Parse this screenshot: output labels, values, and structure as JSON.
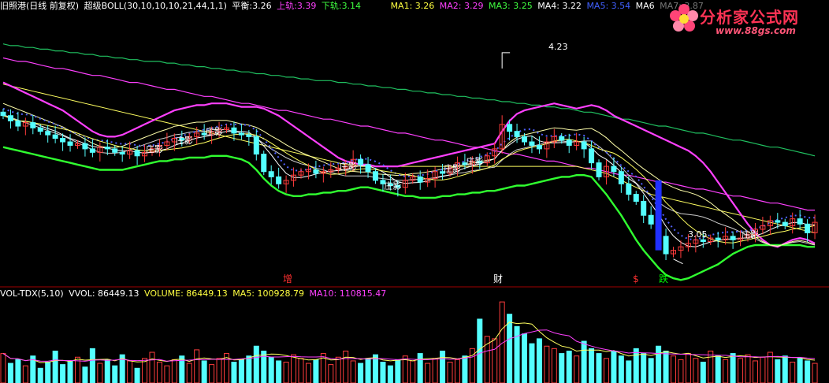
{
  "header": {
    "stock": "旧照港(日线 前复权)",
    "indicator": "超级BOLL(30,10,10,10,21,44,1,1)",
    "balance_label": "平衡:",
    "balance_value": "3.26",
    "upper_label": "上轨:",
    "upper_value": "3.39",
    "lower_label": "下轨:",
    "lower_value": "3.14",
    "ma1": "MA1: 3.26",
    "ma2": "MA2: 3.29",
    "ma3": "MA3: 3.25",
    "ma4": "MA4: 3.22",
    "ma5": "MA5: 3.54",
    "ma6": "MA6",
    "ma7": "MA7: 3.87"
  },
  "vol_header": {
    "name": "VOL-TDX(5,10)",
    "vvol": "VVOL: 86449.13",
    "volume": "VOLUME: 86449.13",
    "ma5": "MA5: 100928.79",
    "ma10": "MA10: 110815.47"
  },
  "logo": {
    "title": "分析家公式网",
    "url": "www.88gs.com"
  },
  "events": [
    {
      "text": "增",
      "color": "#ff3030"
    },
    {
      "text": "财",
      "color": "#ffffff"
    },
    {
      "text": "$",
      "color": "#ff3030"
    },
    {
      "text": "跌",
      "color": "#00ff00"
    }
  ],
  "labels": {
    "high": "4.23",
    "low": "3.05",
    "zhuang": "庄影"
  },
  "colors": {
    "up": "#ff3c3c",
    "down": "#54ffff",
    "upper_band": "#ff40ff",
    "lower_band": "#30ff30",
    "mid_band": "#ffffff",
    "ma_long1": "#ff40ff",
    "ma_long2": "#ffff60",
    "ma_long3": "#20c060",
    "dots": "#5060ff",
    "axis": "#a00000"
  },
  "chart_data": {
    "type": "candlestick",
    "ylim": [
      2.9,
      4.45
    ],
    "grid": false,
    "n_bars": 110,
    "band_upper": [
      4.06,
      4.04,
      4.02,
      4.0,
      3.98,
      3.96,
      3.94,
      3.92,
      3.9,
      3.87,
      3.84,
      3.81,
      3.78,
      3.76,
      3.75,
      3.75,
      3.76,
      3.78,
      3.8,
      3.82,
      3.84,
      3.86,
      3.88,
      3.9,
      3.91,
      3.92,
      3.93,
      3.93,
      3.94,
      3.94,
      3.94,
      3.93,
      3.92,
      3.92,
      3.92,
      3.91,
      3.89,
      3.87,
      3.84,
      3.81,
      3.78,
      3.75,
      3.72,
      3.69,
      3.66,
      3.63,
      3.61,
      3.6,
      3.59,
      3.59,
      3.58,
      3.58,
      3.58,
      3.58,
      3.59,
      3.6,
      3.61,
      3.62,
      3.63,
      3.64,
      3.65,
      3.66,
      3.67,
      3.68,
      3.69,
      3.7,
      3.71,
      3.78,
      3.84,
      3.88,
      3.9,
      3.91,
      3.92,
      3.93,
      3.94,
      3.93,
      3.92,
      3.91,
      3.92,
      3.93,
      3.92,
      3.9,
      3.87,
      3.85,
      3.83,
      3.81,
      3.79,
      3.77,
      3.75,
      3.73,
      3.71,
      3.69,
      3.67,
      3.64,
      3.6,
      3.55,
      3.49,
      3.43,
      3.37,
      3.31,
      3.25,
      3.2,
      3.16,
      3.13,
      3.12,
      3.14,
      3.16,
      3.17,
      3.16,
      3.14
    ],
    "band_lower": [
      3.69,
      3.68,
      3.67,
      3.66,
      3.65,
      3.64,
      3.63,
      3.62,
      3.61,
      3.6,
      3.59,
      3.58,
      3.57,
      3.56,
      3.56,
      3.56,
      3.56,
      3.57,
      3.58,
      3.59,
      3.6,
      3.61,
      3.61,
      3.62,
      3.62,
      3.63,
      3.63,
      3.63,
      3.64,
      3.64,
      3.64,
      3.63,
      3.62,
      3.6,
      3.56,
      3.51,
      3.47,
      3.44,
      3.42,
      3.41,
      3.41,
      3.42,
      3.42,
      3.43,
      3.43,
      3.44,
      3.44,
      3.45,
      3.46,
      3.46,
      3.45,
      3.44,
      3.43,
      3.42,
      3.41,
      3.41,
      3.4,
      3.4,
      3.4,
      3.41,
      3.41,
      3.42,
      3.42,
      3.43,
      3.43,
      3.44,
      3.44,
      3.45,
      3.46,
      3.47,
      3.47,
      3.48,
      3.49,
      3.5,
      3.51,
      3.52,
      3.52,
      3.53,
      3.53,
      3.52,
      3.47,
      3.42,
      3.36,
      3.3,
      3.23,
      3.16,
      3.1,
      3.05,
      3.0,
      2.96,
      2.94,
      2.93,
      2.94,
      2.96,
      2.98,
      3.0,
      3.02,
      3.05,
      3.08,
      3.1,
      3.12,
      3.13,
      3.13,
      3.13,
      3.13,
      3.13,
      3.13,
      3.13,
      3.12,
      3.12
    ],
    "ma_long1": [
      4.2,
      4.19,
      4.18,
      4.18,
      4.17,
      4.16,
      4.15,
      4.14,
      4.14,
      4.13,
      4.12,
      4.11,
      4.1,
      4.1,
      4.09,
      4.08,
      4.07,
      4.06,
      4.06,
      4.05,
      4.04,
      4.03,
      4.02,
      4.02,
      4.01,
      4.0,
      3.99,
      3.98,
      3.98,
      3.97,
      3.96,
      3.95,
      3.94,
      3.94,
      3.93,
      3.92,
      3.91,
      3.9,
      3.9,
      3.89,
      3.88,
      3.87,
      3.86,
      3.85,
      3.85,
      3.84,
      3.83,
      3.82,
      3.81,
      3.81,
      3.8,
      3.79,
      3.78,
      3.77,
      3.77,
      3.76,
      3.75,
      3.74,
      3.73,
      3.73,
      3.72,
      3.71,
      3.7,
      3.69,
      3.69,
      3.68,
      3.67,
      3.66,
      3.65,
      3.65,
      3.64,
      3.63,
      3.62,
      3.61,
      3.61,
      3.6,
      3.59,
      3.58,
      3.57,
      3.57,
      3.56,
      3.55,
      3.54,
      3.53,
      3.53,
      3.52,
      3.51,
      3.5,
      3.49,
      3.49,
      3.48,
      3.47,
      3.46,
      3.45,
      3.45,
      3.44,
      3.43,
      3.42,
      3.41,
      3.41,
      3.4,
      3.39,
      3.38,
      3.37,
      3.37,
      3.36,
      3.35,
      3.34,
      3.33,
      3.33
    ],
    "ma_long2": [
      4.05,
      4.04,
      4.03,
      4.02,
      4.01,
      4.0,
      3.99,
      3.98,
      3.97,
      3.96,
      3.95,
      3.94,
      3.93,
      3.92,
      3.91,
      3.9,
      3.89,
      3.88,
      3.87,
      3.86,
      3.85,
      3.84,
      3.83,
      3.82,
      3.81,
      3.8,
      3.79,
      3.78,
      3.77,
      3.76,
      3.75,
      3.74,
      3.73,
      3.72,
      3.71,
      3.7,
      3.69,
      3.68,
      3.67,
      3.66,
      3.65,
      3.64,
      3.63,
      3.62,
      3.61,
      3.6,
      3.59,
      3.59,
      3.58,
      3.58,
      3.58,
      3.58,
      3.58,
      3.58,
      3.58,
      3.58,
      3.58,
      3.58,
      3.58,
      3.58,
      3.58,
      3.58,
      3.58,
      3.58,
      3.58,
      3.58,
      3.58,
      3.58,
      3.58,
      3.58,
      3.58,
      3.58,
      3.58,
      3.58,
      3.58,
      3.58,
      3.58,
      3.58,
      3.57,
      3.56,
      3.55,
      3.54,
      3.52,
      3.5,
      3.48,
      3.46,
      3.44,
      3.42,
      3.41,
      3.4,
      3.39,
      3.38,
      3.37,
      3.36,
      3.35,
      3.34,
      3.33,
      3.32,
      3.31,
      3.3,
      3.29,
      3.28,
      3.27,
      3.26,
      3.25,
      3.24,
      3.23,
      3.22,
      3.21,
      3.2
    ],
    "ma_long3": [
      4.28,
      4.27,
      4.27,
      4.26,
      4.26,
      4.25,
      4.25,
      4.24,
      4.24,
      4.23,
      4.23,
      4.22,
      4.22,
      4.21,
      4.21,
      4.2,
      4.2,
      4.19,
      4.19,
      4.18,
      4.18,
      4.18,
      4.17,
      4.17,
      4.16,
      4.16,
      4.15,
      4.15,
      4.14,
      4.14,
      4.13,
      4.13,
      4.12,
      4.12,
      4.11,
      4.11,
      4.1,
      4.1,
      4.09,
      4.09,
      4.08,
      4.08,
      4.07,
      4.07,
      4.07,
      4.06,
      4.06,
      4.05,
      4.05,
      4.04,
      4.04,
      4.03,
      4.03,
      4.02,
      4.02,
      4.01,
      4.01,
      4.0,
      4.0,
      3.99,
      3.99,
      3.98,
      3.98,
      3.97,
      3.97,
      3.96,
      3.96,
      3.95,
      3.95,
      3.94,
      3.94,
      3.93,
      3.93,
      3.92,
      3.92,
      3.91,
      3.91,
      3.9,
      3.89,
      3.89,
      3.88,
      3.87,
      3.86,
      3.85,
      3.85,
      3.84,
      3.83,
      3.82,
      3.81,
      3.81,
      3.8,
      3.79,
      3.78,
      3.77,
      3.77,
      3.76,
      3.75,
      3.74,
      3.73,
      3.73,
      3.72,
      3.71,
      3.7,
      3.69,
      3.69,
      3.68,
      3.67,
      3.66,
      3.65,
      3.64
    ],
    "close": [
      3.87,
      3.84,
      3.81,
      3.83,
      3.8,
      3.78,
      3.76,
      3.74,
      3.72,
      3.7,
      3.71,
      3.68,
      3.66,
      3.69,
      3.68,
      3.66,
      3.65,
      3.67,
      3.64,
      3.66,
      3.68,
      3.7,
      3.72,
      3.74,
      3.73,
      3.75,
      3.77,
      3.76,
      3.78,
      3.79,
      3.8,
      3.77,
      3.76,
      3.75,
      3.65,
      3.55,
      3.52,
      3.48,
      3.5,
      3.53,
      3.55,
      3.56,
      3.54,
      3.55,
      3.56,
      3.57,
      3.58,
      3.62,
      3.59,
      3.55,
      3.5,
      3.48,
      3.47,
      3.46,
      3.5,
      3.52,
      3.49,
      3.51,
      3.55,
      3.54,
      3.57,
      3.6,
      3.59,
      3.61,
      3.6,
      3.64,
      3.68,
      3.82,
      3.78,
      3.75,
      3.72,
      3.7,
      3.68,
      3.72,
      3.75,
      3.73,
      3.7,
      3.72,
      3.68,
      3.6,
      3.52,
      3.58,
      3.55,
      3.48,
      3.42,
      3.38,
      3.3,
      3.25,
      3.18,
      3.08,
      3.1,
      3.12,
      3.14,
      3.16,
      3.15,
      3.17,
      3.16,
      3.18,
      3.16,
      3.17,
      3.19,
      3.22,
      3.24,
      3.27,
      3.26,
      3.24,
      3.28,
      3.25,
      3.2,
      3.26
    ],
    "high_label": {
      "bar": 67,
      "value": 4.23
    },
    "low_label": {
      "bar": 90,
      "value": 3.05
    },
    "volume": [
      120,
      80,
      95,
      70,
      110,
      60,
      85,
      130,
      75,
      90,
      105,
      65,
      140,
      80,
      95,
      70,
      115,
      90,
      60,
      100,
      125,
      85,
      70,
      95,
      110,
      80,
      135,
      90,
      75,
      100,
      120,
      85,
      95,
      110,
      150,
      130,
      105,
      90,
      85,
      115,
      100,
      80,
      95,
      120,
      75,
      105,
      130,
      90,
      80,
      100,
      115,
      85,
      70,
      95,
      110,
      90,
      120,
      80,
      100,
      130,
      85,
      95,
      110,
      140,
      260,
      190,
      180,
      330,
      280,
      230,
      200,
      160,
      180,
      150,
      140,
      120,
      130,
      110,
      170,
      140,
      120,
      100,
      130,
      110,
      90,
      140,
      120,
      100,
      150,
      130,
      110,
      95,
      120,
      100,
      85,
      130,
      110,
      95,
      120,
      100,
      115,
      90,
      105,
      125,
      95,
      110,
      85,
      100,
      90,
      80
    ],
    "vol_max": 340
  }
}
